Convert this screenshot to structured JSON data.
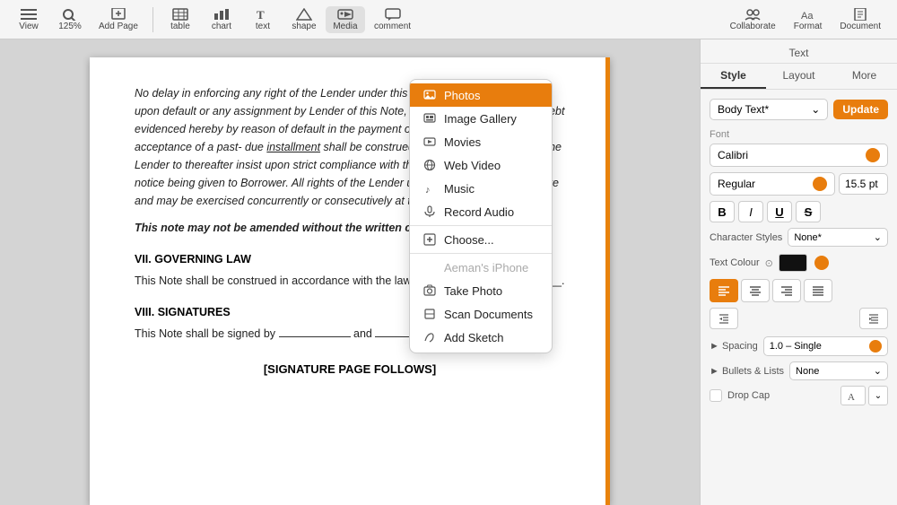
{
  "toolbar": {
    "view_label": "View",
    "zoom_label": "125%",
    "add_page_label": "Add Page",
    "table_icon": "table",
    "chart_icon": "chart",
    "text_icon": "text",
    "shape_icon": "shape",
    "media_icon": "media",
    "comment_icon": "comment",
    "collaborate_label": "Collaborate",
    "format_label": "Format",
    "document_label": "Document"
  },
  "media_menu": {
    "photos_label": "Photos",
    "image_gallery_label": "Image Gallery",
    "movies_label": "Movies",
    "web_video_label": "Web Video",
    "music_label": "Music",
    "record_audio_label": "Record Audio",
    "choose_label": "Choose...",
    "iphone_section": "Aeman's iPhone",
    "take_photo_label": "Take Photo",
    "scan_documents_label": "Scan Documents",
    "add_sketch_label": "Add Sketch"
  },
  "document": {
    "para1": "No delay in enforcing any right of the Lender under this Note, or waiver of any right upon default or any assignment by Lender of this Note, or failure to accelerate the debt evidenced hereby by reason of default in the payment of a monthly installment or acceptance of a past- due installment shall be construed as a waiver of the right of the Lender to thereafter insist upon strict compliance with the terms of this Note without notice being given to Borrower. All rights of the Lender under this Note are cumulative and may be exercised concurrently or consecutively at the Lender's option.",
    "para2_label": "This note may not be amended without the written consent of the holder.",
    "section7_title": "VII. GOVERNING LAW",
    "section7_text": "This Note shall be construed in accordance with the laws of the State of ___________.",
    "section8_title": "VIII. SIGNATURES",
    "section8_text": "This Note shall be signed by ___________ and ___________.",
    "signature_page": "[SIGNATURE PAGE FOLLOWS]"
  },
  "right_panel": {
    "title": "Text",
    "tab_style": "Style",
    "tab_layout": "Layout",
    "tab_more": "More",
    "style_name": "Body Text*",
    "update_btn": "Update",
    "font_section": "Font",
    "font_name": "Calibri",
    "font_style": "Regular",
    "font_size": "15.5 pt",
    "bold": "B",
    "italic": "I",
    "underline": "U",
    "strikethrough": "S",
    "char_styles_label": "Character Styles",
    "char_styles_value": "None*",
    "text_color_label": "Text Colour",
    "spacing_label": "Spacing",
    "spacing_value": "1.0 – Single",
    "bullets_label": "Bullets & Lists",
    "bullets_value": "None",
    "dropcap_label": "Drop Cap"
  }
}
